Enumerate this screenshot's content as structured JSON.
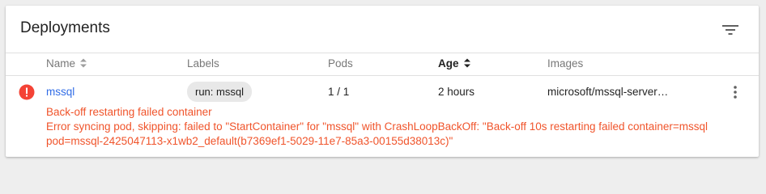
{
  "card": {
    "title": "Deployments",
    "filter_icon": "filter-list-icon"
  },
  "columns": {
    "name": "Name",
    "labels": "Labels",
    "pods": "Pods",
    "age": "Age",
    "images": "Images"
  },
  "sort": {
    "active_column": "Age"
  },
  "deployment": {
    "status_icon": "error-icon",
    "status_color": "#f44336",
    "name": "mssql",
    "label": "run: mssql",
    "pods": "1 / 1",
    "age": "2 hours",
    "images": "microsoft/mssql-server…",
    "more_icon": "more-vert-icon",
    "errors": [
      "Back-off restarting failed container",
      "Error syncing pod, skipping: failed to \"StartContainer\" for \"mssql\" with CrashLoopBackOff: \"Back-off 10s restarting failed container=mssql",
      "pod=mssql-2425047113-x1wb2_default(b7369ef1-5029-11e7-85a3-00155d38013c)\""
    ]
  },
  "colors": {
    "link": "#326de6",
    "error_text": "#f0542b"
  }
}
